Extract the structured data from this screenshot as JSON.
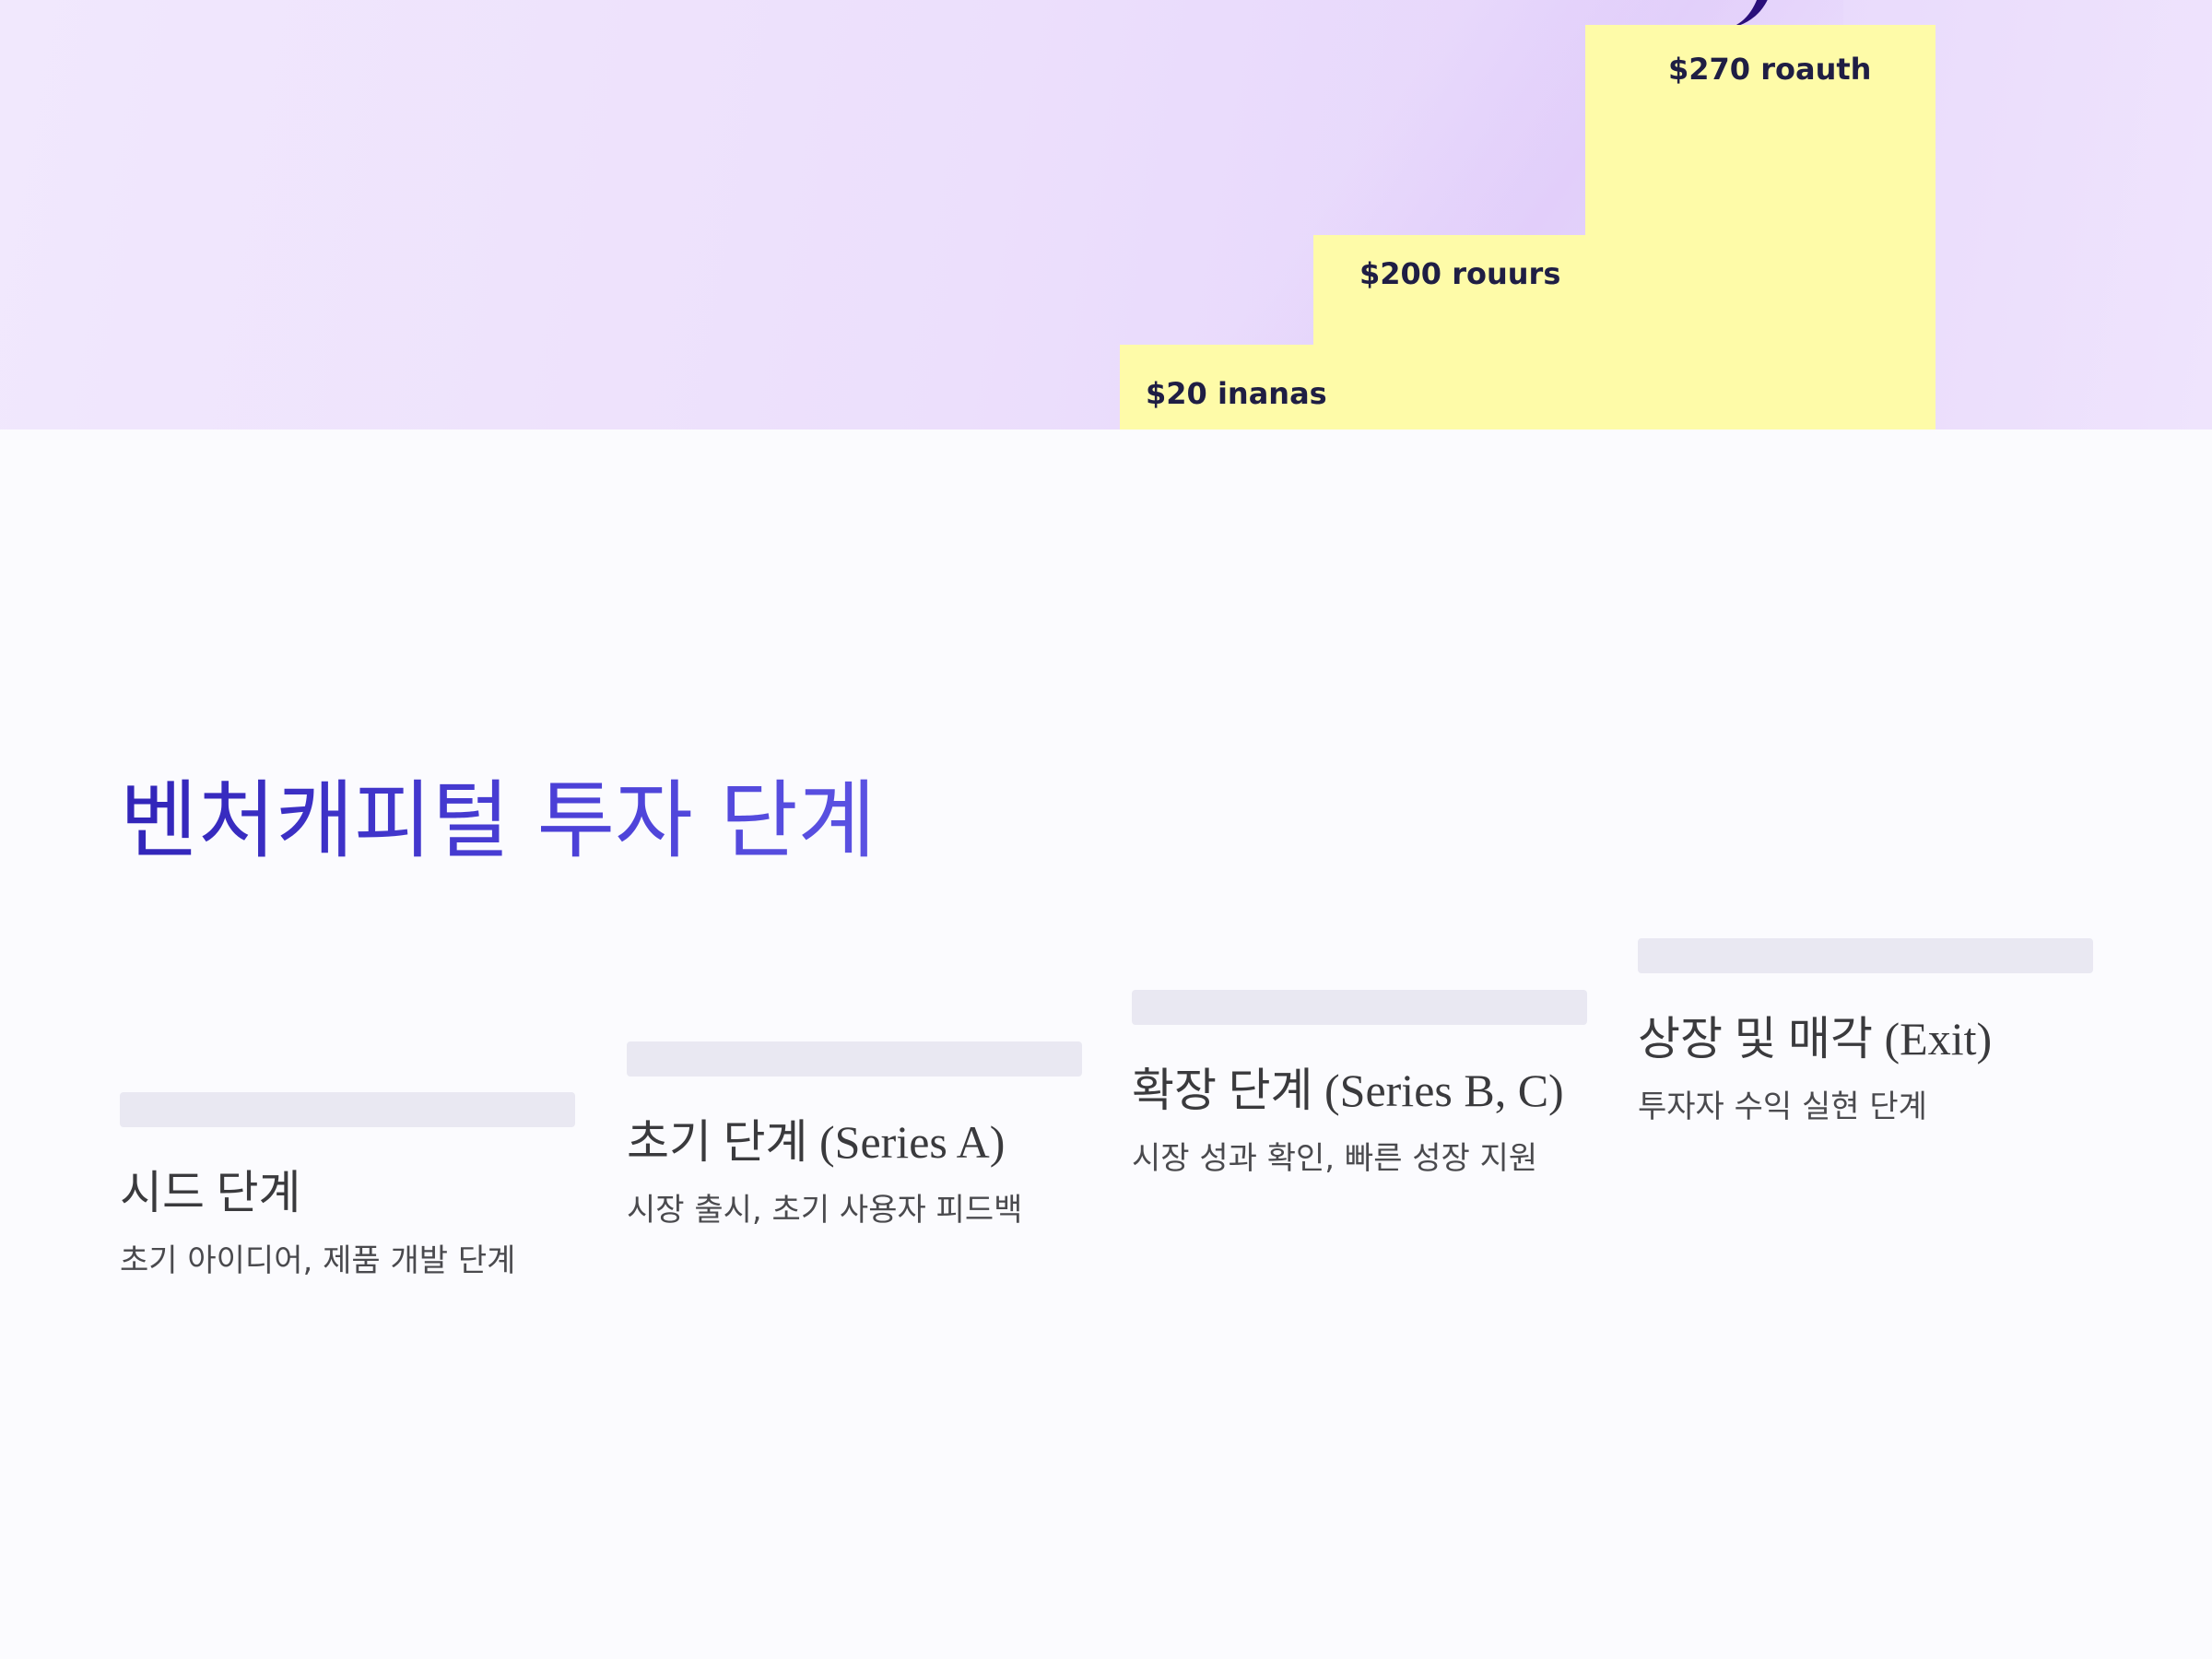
{
  "hero": {
    "step_labels": [
      "$20 inanas",
      "$200 rouurs",
      "$270 roauth"
    ]
  },
  "title": "벤처캐피털 투자 단계",
  "stages": [
    {
      "name": "시드 단계",
      "description": "초기 아이디어, 제품 개발 단계"
    },
    {
      "name": "초기 단계 (Series A)",
      "description": "시장 출시, 초기 사용자 피드백"
    },
    {
      "name": "확장 단계 (Series B, C)",
      "description": "시장 성과 확인, 빠른 성장 지원"
    },
    {
      "name": "상장 및 매각 (Exit)",
      "description": "투자자 수익 실현 단계"
    }
  ],
  "colors": {
    "title_gradient_start": "#3124b8",
    "title_gradient_end": "#5b52e2",
    "step_fill": "#fefba8",
    "hero_background": "#ecdffc"
  }
}
